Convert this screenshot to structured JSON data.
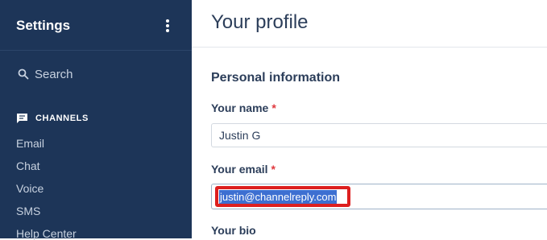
{
  "sidebar": {
    "title": "Settings",
    "search_label": "Search",
    "section": {
      "label": "CHANNELS",
      "icon": "chat-bubble-icon"
    },
    "items": [
      {
        "label": "Email"
      },
      {
        "label": "Chat"
      },
      {
        "label": "Voice"
      },
      {
        "label": "SMS"
      },
      {
        "label": "Help Center"
      }
    ]
  },
  "main": {
    "title": "Your profile",
    "section_title": "Personal information",
    "fields": {
      "name": {
        "label": "Your name",
        "required_mark": "*",
        "value": "Justin G"
      },
      "email": {
        "label": "Your email",
        "required_mark": "*",
        "value": "justin@channelreply.com"
      },
      "bio": {
        "label": "Your bio"
      }
    }
  },
  "colors": {
    "sidebar_bg": "#1d3558",
    "accent_text": "#2c3e5a",
    "required": "#e0393e",
    "highlight_box": "#dd1f1f",
    "selection": "#3d6fd1"
  }
}
